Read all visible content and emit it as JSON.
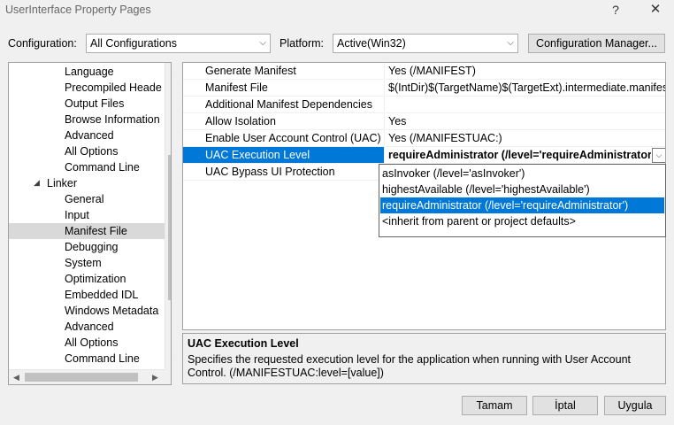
{
  "window": {
    "title": "UserInterface Property Pages",
    "help_glyph": "?",
    "close_glyph": "✕"
  },
  "toolbar": {
    "configuration_label": "Configuration:",
    "configuration_value": "All Configurations",
    "platform_label": "Platform:",
    "platform_value": "Active(Win32)",
    "config_manager_label": "Configuration Manager..."
  },
  "tree": {
    "items": [
      {
        "label": "Language"
      },
      {
        "label": "Precompiled Heade"
      },
      {
        "label": "Output Files"
      },
      {
        "label": "Browse Information"
      },
      {
        "label": "Advanced"
      },
      {
        "label": "All Options"
      },
      {
        "label": "Command Line"
      },
      {
        "label": "Linker"
      },
      {
        "label": "General"
      },
      {
        "label": "Input"
      },
      {
        "label": "Manifest File"
      },
      {
        "label": "Debugging"
      },
      {
        "label": "System"
      },
      {
        "label": "Optimization"
      },
      {
        "label": "Embedded IDL"
      },
      {
        "label": "Windows Metadata"
      },
      {
        "label": "Advanced"
      },
      {
        "label": "All Options"
      },
      {
        "label": "Command Line"
      }
    ],
    "selected": "Manifest File"
  },
  "grid": {
    "rows": [
      {
        "name": "Generate Manifest",
        "value": "Yes (/MANIFEST)"
      },
      {
        "name": "Manifest File",
        "value": "$(IntDir)$(TargetName)$(TargetExt).intermediate.manifest"
      },
      {
        "name": "Additional Manifest Dependencies",
        "value": ""
      },
      {
        "name": "Allow Isolation",
        "value": "Yes"
      },
      {
        "name": "Enable User Account Control (UAC)",
        "value": "Yes (/MANIFESTUAC:)"
      },
      {
        "name": "UAC Execution Level",
        "value": "requireAdministrator (/level='requireAdministrator')"
      },
      {
        "name": "UAC Bypass UI Protection",
        "value": ""
      }
    ],
    "selected": "UAC Execution Level"
  },
  "dropdown": {
    "options": [
      {
        "label": "asInvoker (/level='asInvoker')"
      },
      {
        "label": "highestAvailable (/level='highestAvailable')"
      },
      {
        "label": "requireAdministrator (/level='requireAdministrator')"
      },
      {
        "label": "<inherit from parent or project defaults>"
      }
    ],
    "selected": "requireAdministrator (/level='requireAdministrator')"
  },
  "description": {
    "title": "UAC Execution Level",
    "text": "Specifies the requested execution level for the application when running with User Account Control. (/MANIFESTUAC:level=[value])"
  },
  "buttons": {
    "ok": "Tamam",
    "cancel": "İptal",
    "apply": "Uygula"
  },
  "colors": {
    "selection": "#0078d7",
    "tree_selection": "#d9d9d9",
    "background": "#f0f0f0"
  }
}
